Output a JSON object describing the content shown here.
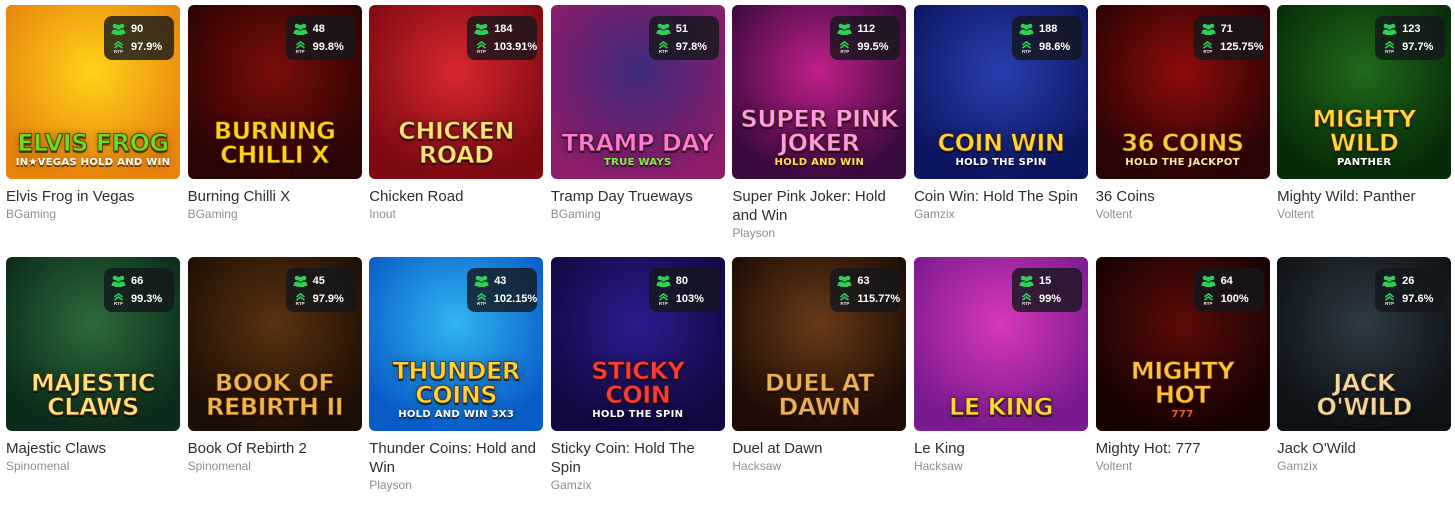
{
  "games": [
    {
      "name": "Elvis Frog in Vegas",
      "provider": "BGaming",
      "players": "90",
      "rtp": "97.9%",
      "art_title": "Elvis Frog",
      "art_sub": "IN★VEGAS HOLD AND WIN",
      "art_icon": "frog-illustration",
      "colors": {
        "bg1": "#ffd31a",
        "bg2": "#e8840c",
        "title": "#6fdc1f",
        "sub": "#ffffff"
      }
    },
    {
      "name": "Burning Chilli X",
      "provider": "BGaming",
      "players": "48",
      "rtp": "99.8%",
      "art_title": "Burning Chilli X",
      "art_sub": "",
      "art_icon": "seven-chilli-illustration",
      "colors": {
        "bg1": "#7a0d0a",
        "bg2": "#2a0402",
        "title": "#ffd21a",
        "sub": "#ffffff"
      }
    },
    {
      "name": "Chicken Road",
      "provider": "Inout",
      "players": "184",
      "rtp": "103.91%",
      "art_title": "Chicken Road",
      "art_sub": "",
      "art_icon": "chicken-illustration",
      "colors": {
        "bg1": "#d9272e",
        "bg2": "#7e0a12",
        "title": "#ffe27a",
        "sub": "#ffffff"
      }
    },
    {
      "name": "Tramp Day Trueways",
      "provider": "BGaming",
      "players": "51",
      "rtp": "97.8%",
      "art_title": "Tramp Day",
      "art_sub": "TRUE WAYS",
      "art_icon": "tramp-dog-illustration",
      "colors": {
        "bg1": "#3e2a7a",
        "bg2": "#8b1d6b",
        "title": "#ff7ad9",
        "sub": "#7cf04a"
      }
    },
    {
      "name": "Super Pink Joker: Hold and Win",
      "provider": "Playson",
      "players": "112",
      "rtp": "99.5%",
      "art_title": "Super Pink Joker",
      "art_sub": "HOLD AND WIN",
      "art_icon": "joker-illustration",
      "colors": {
        "bg1": "#c01f8a",
        "bg2": "#3b0a3f",
        "title": "#ff9de3",
        "sub": "#ffe14a"
      }
    },
    {
      "name": "Coin Win: Hold The Spin",
      "provider": "Gamzix",
      "players": "188",
      "rtp": "98.6%",
      "art_title": "Coin Win",
      "art_sub": "HOLD THE SPIN",
      "art_icon": "coin-illustration",
      "colors": {
        "bg1": "#2a3fb0",
        "bg2": "#0c1660",
        "title": "#ffd43a",
        "sub": "#ffffff"
      }
    },
    {
      "name": "36 Coins",
      "provider": "Voltent",
      "players": "71",
      "rtp": "125.75%",
      "art_title": "36 Coins",
      "art_sub": "HOLD THE JACKPOT",
      "art_icon": "coins-illustration",
      "colors": {
        "bg1": "#8e0c0c",
        "bg2": "#2a0303",
        "title": "#ffc83a",
        "sub": "#ffe9a8"
      }
    },
    {
      "name": "Mighty Wild: Panther",
      "provider": "Voltent",
      "players": "123",
      "rtp": "97.7%",
      "art_title": "Mighty Wild",
      "art_sub": "PANTHER",
      "art_icon": "panther-illustration",
      "colors": {
        "bg1": "#1f6b1a",
        "bg2": "#072b08",
        "title": "#ffd93a",
        "sub": "#ffffff"
      }
    },
    {
      "name": "Majestic Claws",
      "provider": "Spinomenal",
      "players": "66",
      "rtp": "99.3%",
      "art_title": "Majestic Claws",
      "art_sub": "",
      "art_icon": "tiger-illustration",
      "colors": {
        "bg1": "#2c6b3a",
        "bg2": "#0b2c1a",
        "title": "#ffe27a",
        "sub": "#ffffff"
      }
    },
    {
      "name": "Book Of Rebirth 2",
      "provider": "Spinomenal",
      "players": "45",
      "rtp": "97.9%",
      "art_title": "Book of Rebirth II",
      "art_sub": "",
      "art_icon": "book-illustration",
      "colors": {
        "bg1": "#5a3210",
        "bg2": "#1e0f04",
        "title": "#f0b64a",
        "sub": "#ffffff"
      }
    },
    {
      "name": "Thunder Coins: Hold and Win",
      "provider": "Playson",
      "players": "43",
      "rtp": "102.15%",
      "art_title": "Thunder Coins",
      "art_sub": "HOLD AND WIN 3X3",
      "art_icon": "thunder-coin-illustration",
      "colors": {
        "bg1": "#2fb6f0",
        "bg2": "#0a5cc8",
        "title": "#ffd23a",
        "sub": "#ffffff"
      }
    },
    {
      "name": "Sticky Coin: Hold The Spin",
      "provider": "Gamzix",
      "players": "80",
      "rtp": "103%",
      "art_title": "Sticky Coin",
      "art_sub": "HOLD THE SPIN",
      "art_icon": "sevens-illustration",
      "colors": {
        "bg1": "#2a1c8e",
        "bg2": "#120840",
        "title": "#ff3a3a",
        "sub": "#ffffff"
      }
    },
    {
      "name": "Duel at Dawn",
      "provider": "Hacksaw",
      "players": "63",
      "rtp": "115.77%",
      "art_title": "Duel at Dawn",
      "art_sub": "",
      "art_icon": "cowboy-illustration",
      "colors": {
        "bg1": "#6a3a18",
        "bg2": "#1c0c04",
        "title": "#e9b25a",
        "sub": "#ffffff"
      }
    },
    {
      "name": "Le King",
      "provider": "Hacksaw",
      "players": "15",
      "rtp": "99%",
      "art_title": "Le King",
      "art_sub": "",
      "art_icon": "raccoon-illustration",
      "colors": {
        "bg1": "#d838b8",
        "bg2": "#7a1a90",
        "title": "#ffd93a",
        "sub": "#ffffff"
      }
    },
    {
      "name": "Mighty Hot: 777",
      "provider": "Voltent",
      "players": "64",
      "rtp": "100%",
      "art_title": "Mighty Hot",
      "art_sub": "777",
      "art_icon": "fire-sevens-illustration",
      "colors": {
        "bg1": "#5c0c08",
        "bg2": "#150201",
        "title": "#ffc03a",
        "sub": "#ff5a2a"
      }
    },
    {
      "name": "Jack O'Wild",
      "provider": "Gamzix",
      "players": "26",
      "rtp": "97.6%",
      "art_title": "Jack O'Wild",
      "art_sub": "",
      "art_icon": "pumpkin-illustration",
      "colors": {
        "bg1": "#2e3a44",
        "bg2": "#0d1216",
        "title": "#f0d9a0",
        "sub": "#ffffff"
      }
    }
  ],
  "labels": {
    "rtp": "RTP"
  },
  "colors": {
    "players_icon": "#2fcf55",
    "rtp_icon": "#2fcf55",
    "name": "#2b2e33",
    "provider": "#8a8e95"
  }
}
